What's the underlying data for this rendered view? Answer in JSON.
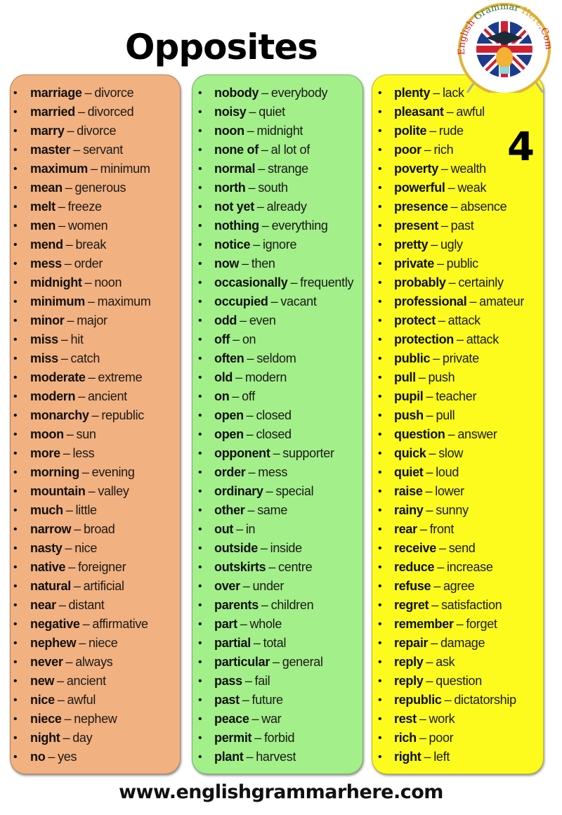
{
  "page": {
    "title": "Opposites",
    "number": "4",
    "footer_url": "www.englishgrammarhere.com",
    "logo_text": "English Grammar Here.Com"
  },
  "colors": {
    "column1_bg": "#f2b180",
    "column2_bg": "#a3ef8a",
    "column3_bg": "#fdfb1e",
    "logo_ring": "#e0b43a",
    "flag_blue": "#1d3a8c",
    "flag_red": "#d22030"
  },
  "columns": [
    {
      "items": [
        {
          "word": "marriage",
          "opposite": "divorce"
        },
        {
          "word": "married",
          "opposite": "divorced"
        },
        {
          "word": "marry",
          "opposite": "divorce"
        },
        {
          "word": "master",
          "opposite": "servant"
        },
        {
          "word": "maximum",
          "opposite": "minimum"
        },
        {
          "word": "mean",
          "opposite": "generous"
        },
        {
          "word": "melt",
          "opposite": "freeze"
        },
        {
          "word": "men",
          "opposite": "women"
        },
        {
          "word": "mend",
          "opposite": "break"
        },
        {
          "word": "mess",
          "opposite": "order"
        },
        {
          "word": "midnight",
          "opposite": "noon"
        },
        {
          "word": "minimum",
          "opposite": "maximum"
        },
        {
          "word": "minor",
          "opposite": "major"
        },
        {
          "word": "miss",
          "opposite": "hit"
        },
        {
          "word": "miss",
          "opposite": "catch"
        },
        {
          "word": "moderate",
          "opposite": "extreme"
        },
        {
          "word": "modern",
          "opposite": "ancient"
        },
        {
          "word": "monarchy",
          "opposite": "republic"
        },
        {
          "word": "moon",
          "opposite": "sun"
        },
        {
          "word": "more",
          "opposite": "less"
        },
        {
          "word": "morning",
          "opposite": "evening"
        },
        {
          "word": "mountain",
          "opposite": "valley"
        },
        {
          "word": "much",
          "opposite": "little"
        },
        {
          "word": "narrow",
          "opposite": "broad"
        },
        {
          "word": "nasty",
          "opposite": "nice"
        },
        {
          "word": "native",
          "opposite": "foreigner"
        },
        {
          "word": "natural",
          "opposite": "artificial"
        },
        {
          "word": "near",
          "opposite": "distant"
        },
        {
          "word": "negative",
          "opposite": "affirmative"
        },
        {
          "word": "nephew",
          "opposite": "niece"
        },
        {
          "word": "never",
          "opposite": "always"
        },
        {
          "word": "new",
          "opposite": "ancient"
        },
        {
          "word": "nice",
          "opposite": "awful"
        },
        {
          "word": "niece",
          "opposite": "nephew"
        },
        {
          "word": "night",
          "opposite": "day"
        },
        {
          "word": "no",
          "opposite": "yes"
        }
      ]
    },
    {
      "items": [
        {
          "word": "nobody",
          "opposite": "everybody"
        },
        {
          "word": "noisy",
          "opposite": "quiet"
        },
        {
          "word": "noon",
          "opposite": "midnight"
        },
        {
          "word": "none of",
          "opposite": "al lot of"
        },
        {
          "word": "normal",
          "opposite": "strange"
        },
        {
          "word": "north",
          "opposite": "south"
        },
        {
          "word": "not yet",
          "opposite": "already"
        },
        {
          "word": "nothing",
          "opposite": "everything"
        },
        {
          "word": "notice",
          "opposite": "ignore"
        },
        {
          "word": "now",
          "opposite": "then"
        },
        {
          "word": "occasionally",
          "opposite": "frequently"
        },
        {
          "word": "occupied",
          "opposite": "vacant"
        },
        {
          "word": "odd",
          "opposite": "even"
        },
        {
          "word": "off",
          "opposite": "on"
        },
        {
          "word": "often",
          "opposite": "seldom"
        },
        {
          "word": "old",
          "opposite": "modern"
        },
        {
          "word": "on",
          "opposite": "off"
        },
        {
          "word": "open",
          "opposite": "closed"
        },
        {
          "word": "open",
          "opposite": "closed"
        },
        {
          "word": "opponent",
          "opposite": "supporter"
        },
        {
          "word": "order",
          "opposite": "mess"
        },
        {
          "word": "ordinary",
          "opposite": "special"
        },
        {
          "word": "other",
          "opposite": "same"
        },
        {
          "word": "out",
          "opposite": "in"
        },
        {
          "word": "outside",
          "opposite": "inside"
        },
        {
          "word": "outskirts",
          "opposite": "centre"
        },
        {
          "word": "over",
          "opposite": "under"
        },
        {
          "word": "parents",
          "opposite": "children"
        },
        {
          "word": "part",
          "opposite": "whole"
        },
        {
          "word": "partial",
          "opposite": "total"
        },
        {
          "word": "particular",
          "opposite": "general"
        },
        {
          "word": "pass",
          "opposite": "fail"
        },
        {
          "word": "past",
          "opposite": "future"
        },
        {
          "word": "peace",
          "opposite": "war"
        },
        {
          "word": "permit",
          "opposite": "forbid"
        },
        {
          "word": "plant",
          "opposite": "harvest"
        }
      ]
    },
    {
      "items": [
        {
          "word": "plenty",
          "opposite": "lack"
        },
        {
          "word": "pleasant",
          "opposite": "awful"
        },
        {
          "word": "polite",
          "opposite": "rude"
        },
        {
          "word": "poor",
          "opposite": "rich"
        },
        {
          "word": "poverty",
          "opposite": "wealth"
        },
        {
          "word": "powerful",
          "opposite": "weak"
        },
        {
          "word": "presence",
          "opposite": "absence"
        },
        {
          "word": "present",
          "opposite": "past"
        },
        {
          "word": "pretty",
          "opposite": "ugly"
        },
        {
          "word": "private",
          "opposite": "public"
        },
        {
          "word": "probably",
          "opposite": "certainly"
        },
        {
          "word": "professional",
          "opposite": "amateur"
        },
        {
          "word": "protect",
          "opposite": "attack"
        },
        {
          "word": "protection",
          "opposite": "attack"
        },
        {
          "word": "public",
          "opposite": "private"
        },
        {
          "word": "pull",
          "opposite": "push"
        },
        {
          "word": "pupil",
          "opposite": "teacher"
        },
        {
          "word": "push",
          "opposite": "pull"
        },
        {
          "word": "question",
          "opposite": "answer"
        },
        {
          "word": "quick",
          "opposite": "slow"
        },
        {
          "word": "quiet",
          "opposite": "loud"
        },
        {
          "word": "raise",
          "opposite": "lower"
        },
        {
          "word": "rainy",
          "opposite": "sunny"
        },
        {
          "word": "rear",
          "opposite": "front"
        },
        {
          "word": "receive",
          "opposite": "send"
        },
        {
          "word": "reduce",
          "opposite": "increase"
        },
        {
          "word": "refuse",
          "opposite": "agree"
        },
        {
          "word": "regret",
          "opposite": "satisfaction"
        },
        {
          "word": "remember",
          "opposite": "forget"
        },
        {
          "word": "repair",
          "opposite": "damage"
        },
        {
          "word": "reply",
          "opposite": "ask"
        },
        {
          "word": "reply",
          "opposite": "question"
        },
        {
          "word": "republic",
          "opposite": "dictatorship"
        },
        {
          "word": "rest",
          "opposite": "work"
        },
        {
          "word": "rich",
          "opposite": "poor"
        },
        {
          "word": "right",
          "opposite": "left"
        }
      ]
    }
  ]
}
